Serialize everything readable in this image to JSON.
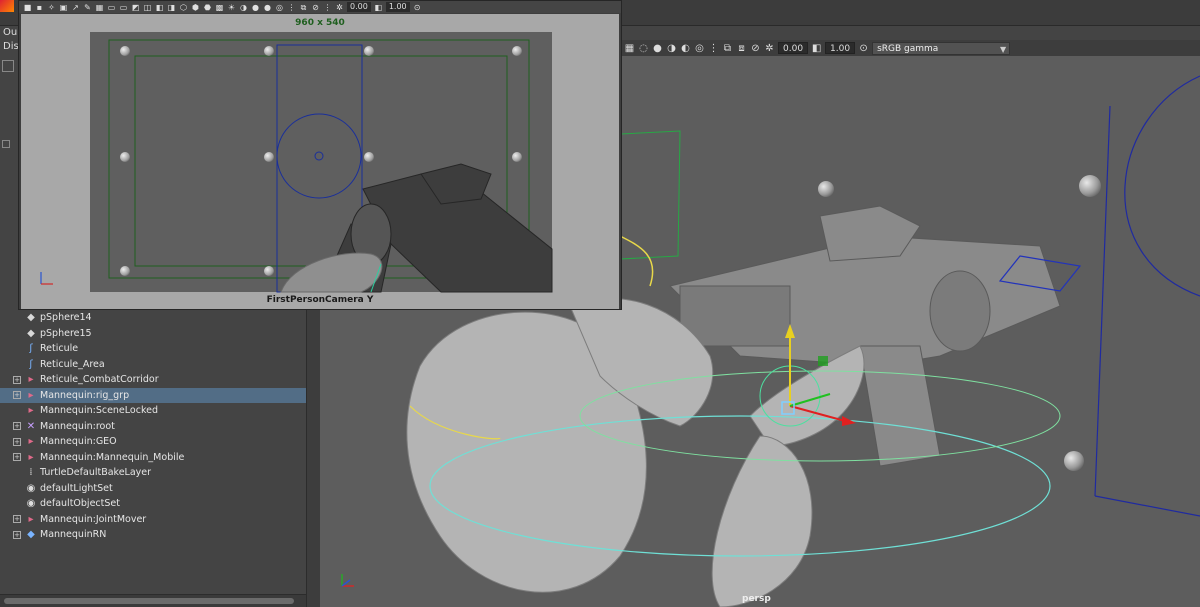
{
  "main_header": {
    "outliner_title": "Ou",
    "display_menu": "Dis"
  },
  "camera_window": {
    "resolution": "960 x 540",
    "camera_name": "FirstPersonCamera Y",
    "exposure": "0.00",
    "gamma": "1.00"
  },
  "viewport": {
    "exposure": "0.00",
    "gamma": "1.00",
    "color_space": "sRGB gamma",
    "camera_label": "persp"
  },
  "outliner": {
    "items": [
      {
        "label": "pSphere14",
        "icon": "mesh-icon",
        "expandable": false,
        "selected": false
      },
      {
        "label": "pSphere15",
        "icon": "mesh-icon",
        "expandable": false,
        "selected": false
      },
      {
        "label": "Reticule",
        "icon": "curve-icon",
        "expandable": false,
        "selected": false
      },
      {
        "label": "Reticule_Area",
        "icon": "curve-icon",
        "expandable": false,
        "selected": false
      },
      {
        "label": "Reticule_CombatCorridor",
        "icon": "reference-icon",
        "expandable": true,
        "selected": false
      },
      {
        "label": "Mannequin:rig_grp",
        "icon": "reference-icon",
        "expandable": true,
        "selected": true
      },
      {
        "label": "Mannequin:SceneLocked",
        "icon": "reference-icon",
        "expandable": false,
        "selected": false
      },
      {
        "label": "Mannequin:root",
        "icon": "joint-icon",
        "expandable": true,
        "selected": false
      },
      {
        "label": "Mannequin:GEO",
        "icon": "reference-icon",
        "expandable": true,
        "selected": false
      },
      {
        "label": "Mannequin:Mannequin_Mobile",
        "icon": "reference-icon",
        "expandable": true,
        "selected": false
      },
      {
        "label": "TurtleDefaultBakeLayer",
        "icon": "bake-layer-icon",
        "expandable": false,
        "selected": false
      },
      {
        "label": "defaultLightSet",
        "icon": "set-icon",
        "expandable": false,
        "selected": false
      },
      {
        "label": "defaultObjectSet",
        "icon": "set-icon",
        "expandable": false,
        "selected": false
      },
      {
        "label": "Mannequin:JointMover",
        "icon": "reference-icon",
        "expandable": true,
        "selected": false
      },
      {
        "label": "MannequinRN",
        "icon": "reference-node-icon",
        "expandable": true,
        "selected": false
      }
    ]
  },
  "colors": {
    "selection": "#526d86",
    "resolution_gate": "#1f5f1f",
    "safe_frame": "#1a2f9a"
  }
}
